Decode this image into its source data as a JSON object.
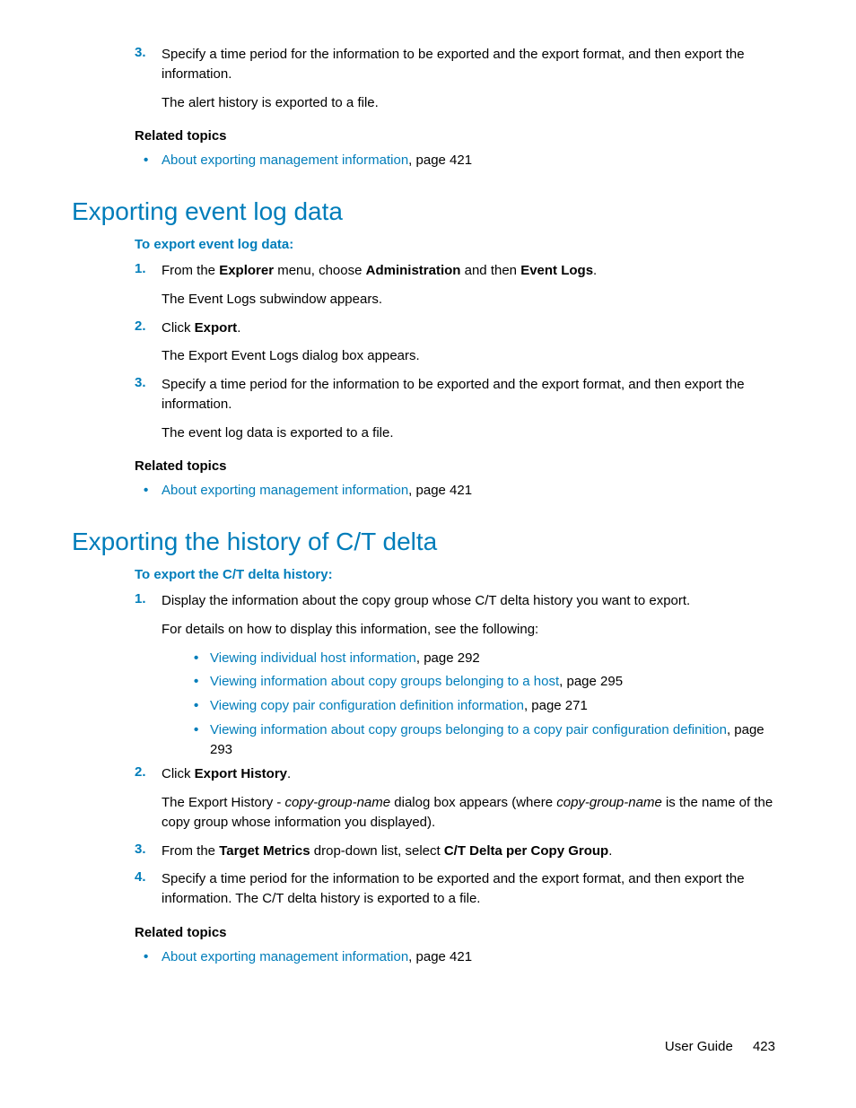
{
  "top": {
    "step3_num": "3.",
    "step3_p1a": "Specify a time period for the information to be exported and the export format, and then export the information.",
    "step3_p2": "The alert history is exported to a file.",
    "related_heading": "Related topics",
    "related_link": "About exporting management information",
    "related_page": ", page 421"
  },
  "eventlog": {
    "heading": "Exporting event log data",
    "sub": "To export event log data:",
    "s1_num": "1.",
    "s1_a": "From the ",
    "s1_b": "Explorer",
    "s1_c": " menu, choose ",
    "s1_d": "Administration",
    "s1_e": " and then ",
    "s1_f": "Event Logs",
    "s1_g": ".",
    "s1_p2": "The Event Logs subwindow appears.",
    "s2_num": "2.",
    "s2_a": "Click ",
    "s2_b": "Export",
    "s2_c": ".",
    "s2_p2": "The Export Event Logs dialog box appears.",
    "s3_num": "3.",
    "s3_p1": "Specify a time period for the information to be exported and the export format, and then export the information.",
    "s3_p2": "The event log data is exported to a file.",
    "related_heading": "Related topics",
    "related_link": "About exporting management information",
    "related_page": ", page 421"
  },
  "ctdelta": {
    "heading": "Exporting the history of C/T delta",
    "sub": "To export the C/T delta history:",
    "s1_num": "1.",
    "s1_p1": "Display the information about the copy group whose C/T delta history you want to export.",
    "s1_p2": "For details on how to display this information, see the following:",
    "b1_link": "Viewing individual host information",
    "b1_pg": ", page 292",
    "b2_link": "Viewing information about copy groups belonging to a host",
    "b2_pg": ", page 295",
    "b3_link": "Viewing copy pair configuration definition information",
    "b3_pg": ", page 271",
    "b4_link": "Viewing information about copy groups belonging to a copy pair configuration definition",
    "b4_pg": ", page 293",
    "s2_num": "2.",
    "s2_a": "Click ",
    "s2_b": "Export History",
    "s2_c": ".",
    "s2_p2a": "The Export History - ",
    "s2_p2b": "copy-group-name",
    "s2_p2c": " dialog box appears (where ",
    "s2_p2d": "copy-group-name",
    "s2_p2e": " is the name of the copy group whose information you displayed).",
    "s3_num": "3.",
    "s3_a": "From the ",
    "s3_b": "Target Metrics",
    "s3_c": " drop-down list, select ",
    "s3_d": "C/T Delta per Copy Group",
    "s3_e": ".",
    "s4_num": "4.",
    "s4_p1": "Specify a time period for the information to be exported and the export format, and then export the information. The C/T delta history is exported to a file.",
    "related_heading": "Related topics",
    "related_link": "About exporting management information",
    "related_page": ", page 421"
  },
  "footer": {
    "label": "User Guide",
    "page": "423"
  }
}
